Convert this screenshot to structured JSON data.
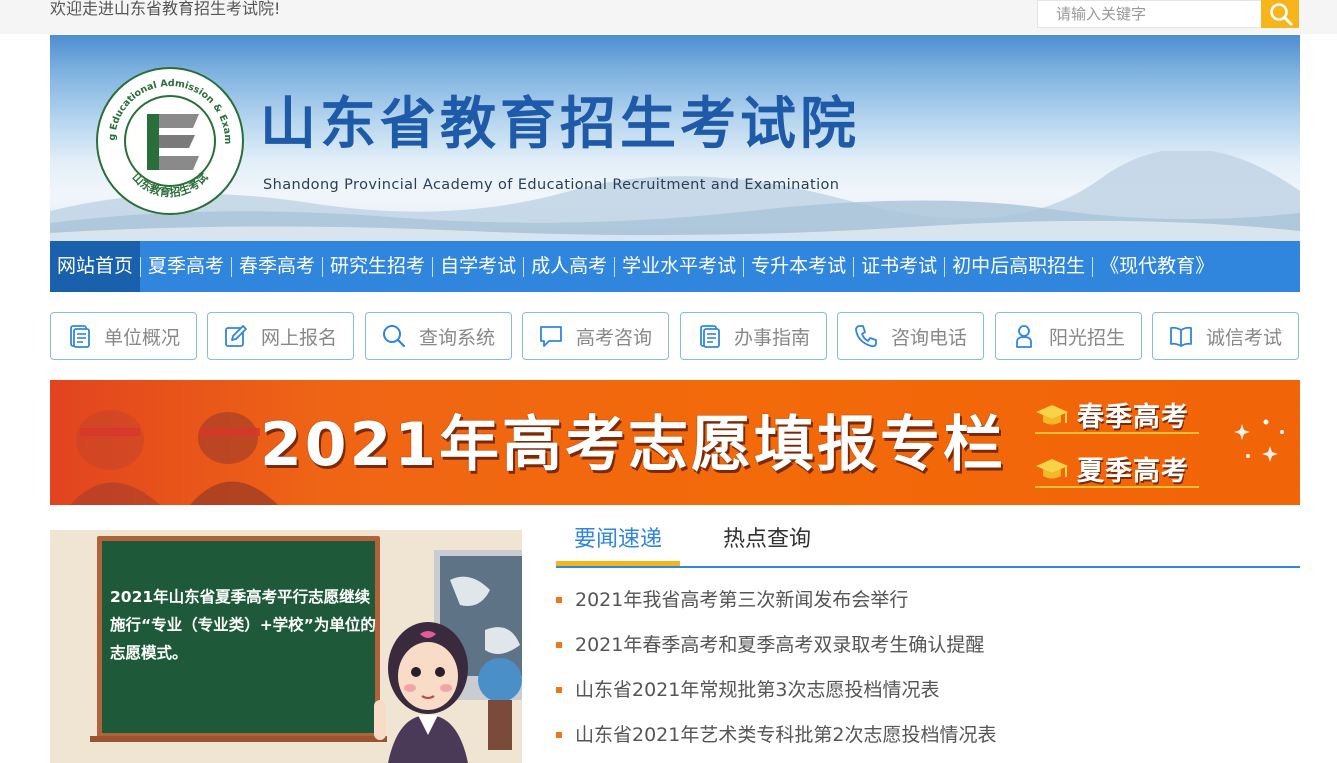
{
  "topbar": {
    "welcome": "欢迎走进山东省教育招生考试院!",
    "search_placeholder": "请输入关键字"
  },
  "header": {
    "title": "山东省教育招生考试院",
    "title_en": "Shandong Provincial Academy of Educational Recruitment and Examination",
    "logo_ring_text": "Shandong Educational Admission & Examinations",
    "logo_seal_text": "山东教育招生考试"
  },
  "nav": {
    "items": [
      {
        "label": "网站首页",
        "active": true
      },
      {
        "label": "夏季高考"
      },
      {
        "label": "春季高考"
      },
      {
        "label": "研究生招考"
      },
      {
        "label": "自学考试"
      },
      {
        "label": "成人高考"
      },
      {
        "label": "学业水平考试"
      },
      {
        "label": "专升本考试"
      },
      {
        "label": "证书考试"
      },
      {
        "label": "初中后高职招生"
      },
      {
        "label": "《现代教育》"
      }
    ]
  },
  "quick_links": [
    {
      "label": "单位概况",
      "icon": "document-icon"
    },
    {
      "label": "网上报名",
      "icon": "edit-icon"
    },
    {
      "label": "查询系统",
      "icon": "search-icon"
    },
    {
      "label": "高考咨询",
      "icon": "chat-icon"
    },
    {
      "label": "办事指南",
      "icon": "guide-icon"
    },
    {
      "label": "咨询电话",
      "icon": "phone-icon"
    },
    {
      "label": "阳光招生",
      "icon": "user-icon"
    },
    {
      "label": "诚信考试",
      "icon": "book-icon"
    }
  ],
  "banner": {
    "title": "2021年高考志愿填报专栏",
    "links": [
      "春季高考",
      "夏季高考"
    ]
  },
  "feature": {
    "board_text": "2021年山东省夏季高考平行志愿继续施行“专业（专业类）+学校”为单位的志愿模式。"
  },
  "news": {
    "tabs": [
      "要闻速递",
      "热点查询"
    ],
    "items": [
      "2021年我省高考第三次新闻发布会举行",
      "2021年春季高考和夏季高考双录取考生确认提醒",
      "山东省2021年常规批第3次志愿投档情况表",
      "山东省2021年艺术类专科批第2次志愿投档情况表"
    ]
  },
  "colors": {
    "nav_blue": "#2f86dc",
    "nav_active": "#1a61ad",
    "accent_yellow": "#f7b51c",
    "banner_orange": "#f36a0a",
    "bullet_orange": "#e87a1c"
  }
}
